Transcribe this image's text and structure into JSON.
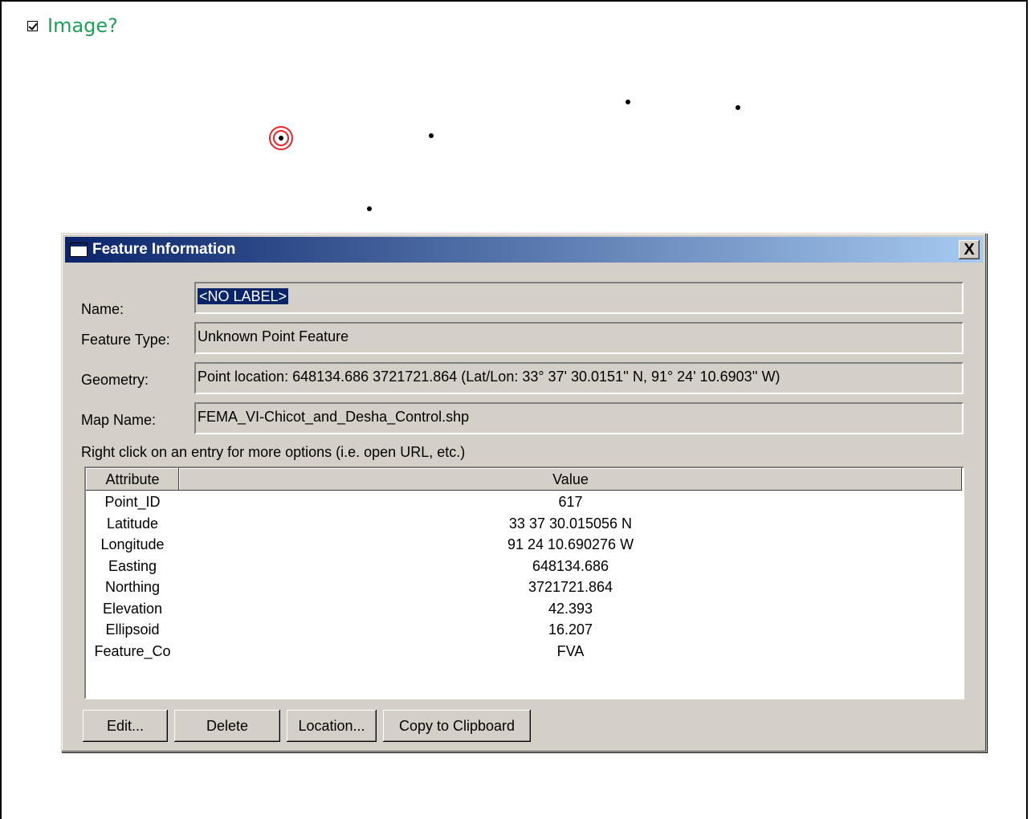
{
  "image_toggle": {
    "label": "Image?",
    "checked": true
  },
  "dialog": {
    "title": "Feature Information",
    "close_label": "X",
    "fields": {
      "name": {
        "label": "Name:",
        "value": "<NO LABEL>"
      },
      "feature_type": {
        "label": "Feature Type:",
        "value": "Unknown Point Feature"
      },
      "geometry": {
        "label": "Geometry:",
        "value": "Point location: 648134.686 3721721.864 (Lat/Lon: 33° 37' 30.0151'' N, 91° 24' 10.6903'' W)"
      },
      "map_name": {
        "label": "Map Name:",
        "value": "FEMA_VI-Chicot_and_Desha_Control.shp"
      }
    },
    "hint": "Right click on an entry for more options (i.e. open URL, etc.)",
    "table": {
      "headers": {
        "attribute": "Attribute",
        "value": "Value"
      },
      "rows": [
        {
          "attribute": "Point_ID",
          "value": "617"
        },
        {
          "attribute": "Latitude",
          "value": "33 37 30.015056 N"
        },
        {
          "attribute": "Longitude",
          "value": "91 24 10.690276 W"
        },
        {
          "attribute": "Easting",
          "value": "648134.686"
        },
        {
          "attribute": "Northing",
          "value": "3721721.864"
        },
        {
          "attribute": "Elevation",
          "value": "42.393"
        },
        {
          "attribute": "Ellipsoid",
          "value": "16.207"
        },
        {
          "attribute": "Feature_Co",
          "value": "FVA"
        }
      ]
    },
    "buttons": {
      "edit": "Edit...",
      "delete": "Delete",
      "location": "Location...",
      "copy": "Copy to Clipboard"
    }
  },
  "colors": {
    "title_start": "#0a246a",
    "title_end": "#a6caf0",
    "marker_ring": "#e8262a",
    "toggle_label": "#1fa05a"
  }
}
